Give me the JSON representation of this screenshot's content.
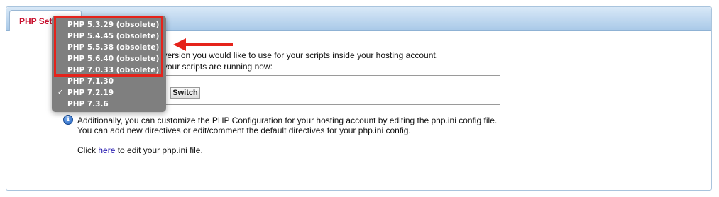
{
  "tab": {
    "label": "PHP Settings"
  },
  "intro": {
    "line1": "Please select which PHP version you would like to use for your scripts inside your hosting account.",
    "line2": "Below is the PHP version your scripts are running now:"
  },
  "switch_label": "Switch",
  "info": {
    "icon": "info-icon",
    "line1": "Additionally, you can customize the PHP Configuration for your hosting account by editing the php.ini config file.",
    "line2": "You can add new directives or edit/comment the default directives for your php.ini config.",
    "click_prefix": "Click",
    "link_text": "here",
    "click_suffix": "to edit your php.ini file."
  },
  "dropdown": {
    "selected": "PHP 7.2.19",
    "options": [
      "PHP 5.3.29 (obsolete)",
      "PHP 5.4.45 (obsolete)",
      "PHP 5.5.38 (obsolete)",
      "PHP 5.6.40 (obsolete)",
      "PHP 7.0.33 (obsolete)",
      "PHP 7.1.30",
      "PHP 7.2.19",
      "PHP 7.3.6"
    ],
    "check_mark": "✓"
  },
  "annotation": {
    "color": "#e5231b"
  },
  "colors": {
    "tab_text": "#c8102e",
    "link": "#1a0dab",
    "menu_bg": "#7f7f7f"
  }
}
